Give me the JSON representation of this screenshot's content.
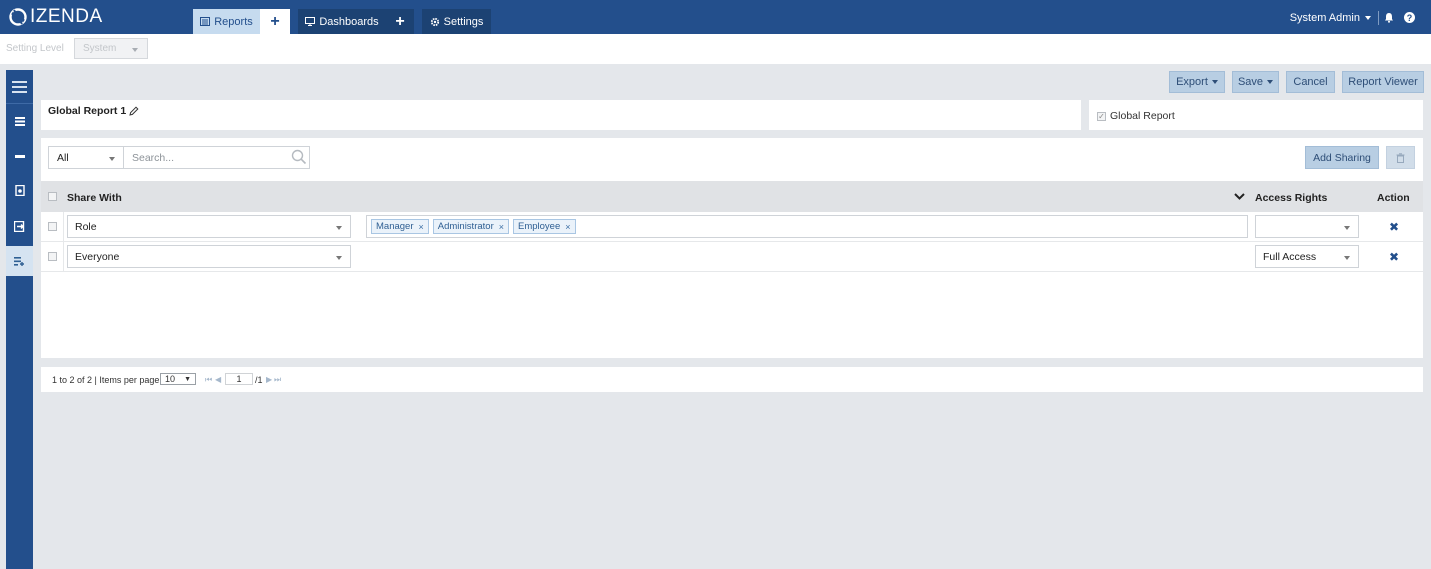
{
  "app": {
    "brand": "IZENDA"
  },
  "nav": {
    "reports": "Reports",
    "dashboards": "Dashboards",
    "settings": "Settings",
    "user": "System Admin",
    "help": "?"
  },
  "setting_level": {
    "label": "Setting Level",
    "value": "System"
  },
  "toolbar": {
    "export": "Export",
    "save": "Save",
    "cancel": "Cancel",
    "report_viewer": "Report Viewer"
  },
  "report": {
    "name": "Global Report 1",
    "global_label": "Global Report",
    "global_checked": true
  },
  "filter": {
    "scope": "All",
    "search_placeholder": "Search..."
  },
  "add_sharing": "Add Sharing",
  "grid": {
    "headers": {
      "share_with": "Share With",
      "access_rights": "Access Rights",
      "action": "Action"
    },
    "rows": [
      {
        "share_with": "Role",
        "roles": [
          "Manager",
          "Administrator",
          "Employee"
        ],
        "access_rights": ""
      },
      {
        "share_with": "Everyone",
        "roles": [],
        "access_rights": "Full Access"
      }
    ]
  },
  "pager": {
    "summary": "1 to 2 of 2 | Items per page",
    "per_page": "10",
    "page": "1",
    "total": "/1"
  },
  "colors": {
    "brand": "#234f8c",
    "button": "#b8cee3",
    "background": "#e4e7eb"
  }
}
